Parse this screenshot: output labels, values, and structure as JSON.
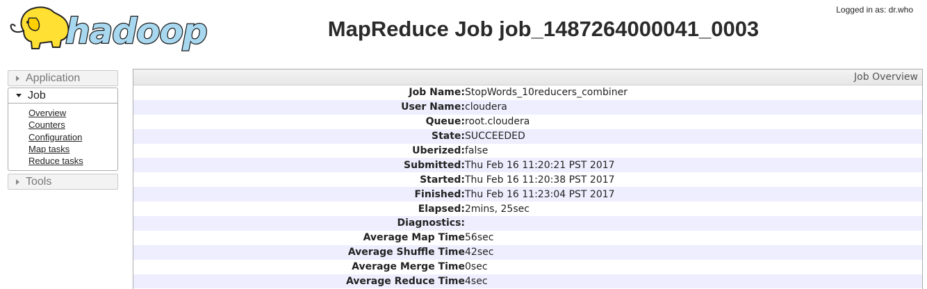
{
  "header": {
    "logo_text": "hadoop",
    "title": "MapReduce Job job_1487264000041_0003",
    "login_text": "Logged in as: dr.who"
  },
  "sidebar": {
    "application_label": "Application",
    "job_label": "Job",
    "job_links": [
      {
        "label": "Overview"
      },
      {
        "label": "Counters"
      },
      {
        "label": "Configuration"
      },
      {
        "label": "Map tasks"
      },
      {
        "label": "Reduce tasks"
      }
    ],
    "tools_label": "Tools"
  },
  "overview": {
    "heading": "Job Overview",
    "rows": [
      {
        "key": "Job Name:",
        "value": "StopWords_10reducers_combiner"
      },
      {
        "key": "User Name:",
        "value": "cloudera"
      },
      {
        "key": "Queue:",
        "value": "root.cloudera"
      },
      {
        "key": "State:",
        "value": "SUCCEEDED"
      },
      {
        "key": "Uberized:",
        "value": "false"
      },
      {
        "key": "Submitted:",
        "value": "Thu Feb 16 11:20:21 PST 2017"
      },
      {
        "key": "Started:",
        "value": "Thu Feb 16 11:20:38 PST 2017"
      },
      {
        "key": "Finished:",
        "value": "Thu Feb 16 11:23:04 PST 2017"
      },
      {
        "key": "Elapsed:",
        "value": "2mins, 25sec"
      },
      {
        "key": "Diagnostics:",
        "value": ""
      },
      {
        "key": "Average Map Time",
        "value": "56sec"
      },
      {
        "key": "Average Shuffle Time",
        "value": "42sec"
      },
      {
        "key": "Average Merge Time",
        "value": "0sec"
      },
      {
        "key": "Average Reduce Time",
        "value": "4sec"
      }
    ]
  },
  "colors": {
    "row_stripe": "#eeeeff",
    "logo_blue": "#a8d8f0",
    "logo_elephant": "#ffe033"
  }
}
